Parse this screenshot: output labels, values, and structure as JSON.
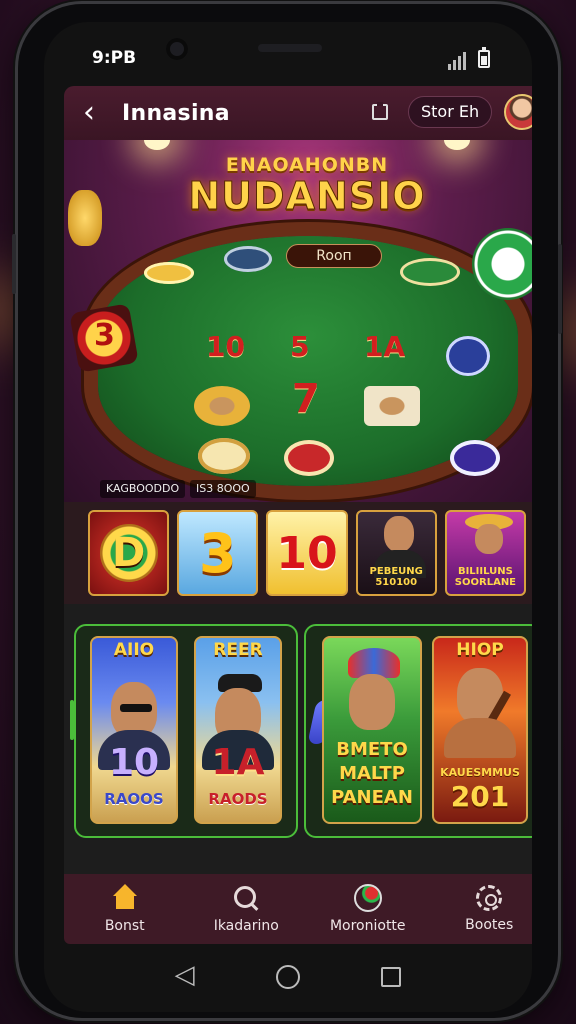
{
  "status_bar": {
    "time": "9:PB"
  },
  "app_bar": {
    "title": "Innasina",
    "store_label": "Stor Eh"
  },
  "hero": {
    "kicker": "ENAOAHONBN",
    "headline": "NUDANSIO",
    "room_label": "Rooп",
    "table_numbers": [
      "10",
      "5",
      "1A",
      "7"
    ],
    "left_badge": "3",
    "footer_left": "KAGBOODDO",
    "footer_right": "IS3 8OOO"
  },
  "featured_tiles": [
    {
      "glyph": "D",
      "caption": ""
    },
    {
      "glyph": "3",
      "caption": ""
    },
    {
      "glyph": "10",
      "caption": ""
    },
    {
      "glyph": "",
      "caption": "PEBEUNG 510100"
    },
    {
      "glyph": "",
      "caption": "BILIILUNS SOORLANE"
    }
  ],
  "game_cards": [
    {
      "top": "AIIO",
      "num": "10",
      "bottom": "RAOOS"
    },
    {
      "top": "REER",
      "num": "1A",
      "bottom": "RAODS"
    },
    {
      "top": "",
      "text": "BMETO MALTP PANEAN"
    },
    {
      "top": "HIOP",
      "num": "201",
      "bottom": "KAUESMMUS"
    }
  ],
  "bottom_nav": [
    {
      "label": "Bonst",
      "icon": "home-icon"
    },
    {
      "label": "Ikadarino",
      "icon": "search-icon"
    },
    {
      "label": "Moroniotte",
      "icon": "profile-icon"
    },
    {
      "label": "Bootes",
      "icon": "settings-icon"
    }
  ],
  "colors": {
    "app_bar": "#3a1524",
    "nav_bar": "#3e1a26",
    "accent_gold": "#ffd34a",
    "panel_border": "#4bbd3a",
    "felt_green": "#1c6d2a"
  }
}
